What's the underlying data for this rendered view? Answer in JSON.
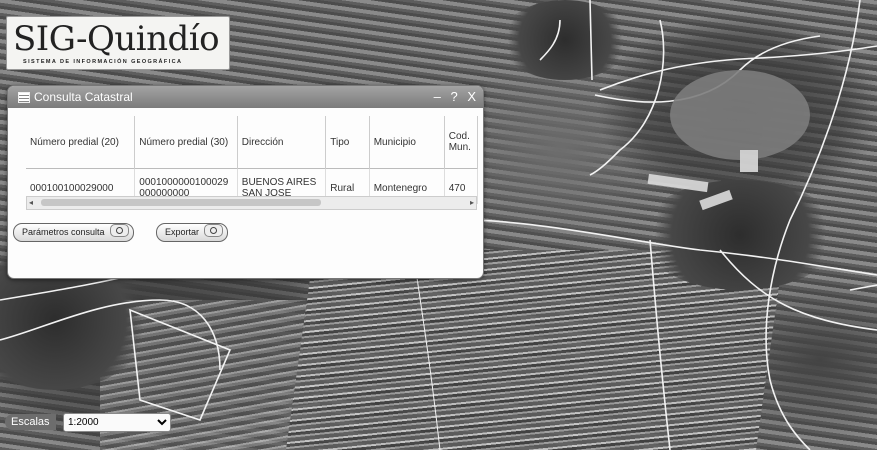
{
  "logo": {
    "title": "SIG-Quindío",
    "subtitle": "SISTEMA DE INFORMACIÓN GEOGRÁFICA"
  },
  "dialog": {
    "title": "Consulta Catastral",
    "controls": {
      "minimize": "–",
      "help": "?",
      "close": "X"
    },
    "columns": [
      "Número predial (20)",
      "Número predial (30)",
      "Dirección",
      "Tipo",
      "Municipio",
      "Cod. Mun."
    ],
    "rows": [
      {
        "predial20": "000100100029000",
        "predial30": "0001000000100029 000000000",
        "direccion": "BUENOS AIRES SAN JOSE",
        "tipo": "Rural",
        "municipio": "Montenegro",
        "cod": "470"
      }
    ],
    "buttons": {
      "params": "Parámetros consulta",
      "export": "Exportar"
    }
  },
  "scale": {
    "label": "Escalas",
    "selected": "1:2000"
  },
  "icons": [
    "window-icon",
    "search-icon",
    "chevron-down-icon"
  ]
}
